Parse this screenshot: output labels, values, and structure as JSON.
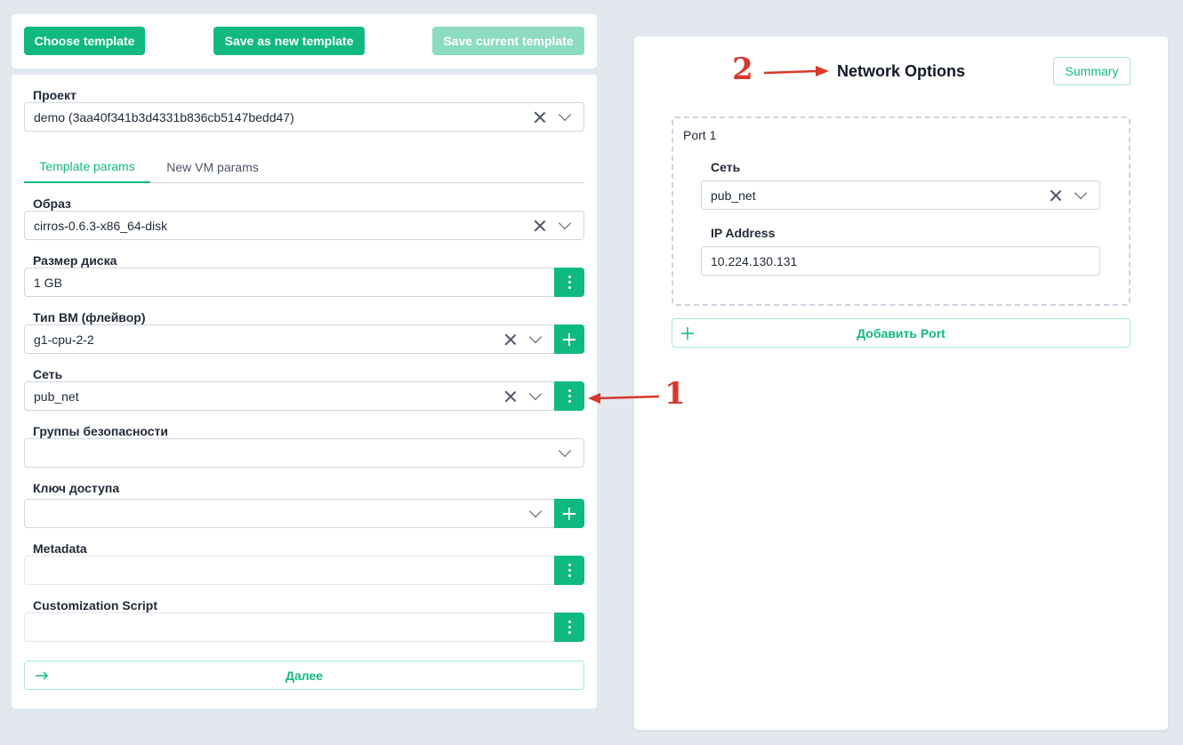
{
  "toolbar": {
    "choose_template": "Choose template",
    "save_new_template": "Save as new template",
    "save_current_template": "Save current template"
  },
  "form": {
    "project": {
      "label": "Проект",
      "value": "demo (3aa40f341b3d4331b836cb5147bedd47)"
    },
    "tabs": [
      {
        "label": "Template params",
        "active": true
      },
      {
        "label": "New VM params",
        "active": false
      }
    ],
    "image": {
      "label": "Образ",
      "value": "cirros-0.6.3-x86_64-disk"
    },
    "disk_size": {
      "label": "Размер диска",
      "value": "1 GB"
    },
    "flavor": {
      "label": "Тип ВМ (флейвор)",
      "value": "g1-cpu-2-2"
    },
    "network": {
      "label": "Сеть",
      "value": "pub_net"
    },
    "security_groups": {
      "label": "Группы безопасности",
      "value": ""
    },
    "access_key": {
      "label": "Ключ доступа",
      "value": ""
    },
    "metadata": {
      "label": "Metadata",
      "value": ""
    },
    "customization_script": {
      "label": "Customization Script",
      "value": ""
    },
    "next_button": "Далее"
  },
  "network_panel": {
    "title": "Network Options",
    "summary_button": "Summary",
    "port": {
      "label": "Port 1",
      "network_label": "Сеть",
      "network_value": "pub_net",
      "ip_label": "IP Address",
      "ip_value": "10.224.130.131"
    },
    "add_port_button": "Добавить Port"
  },
  "annotations": {
    "marker_1": "1",
    "marker_2": "2"
  },
  "colors": {
    "accent": "#10b981",
    "accent_disabled": "#8ddcbf",
    "background": "#e3e8ef",
    "annotation": "#d7382c"
  }
}
